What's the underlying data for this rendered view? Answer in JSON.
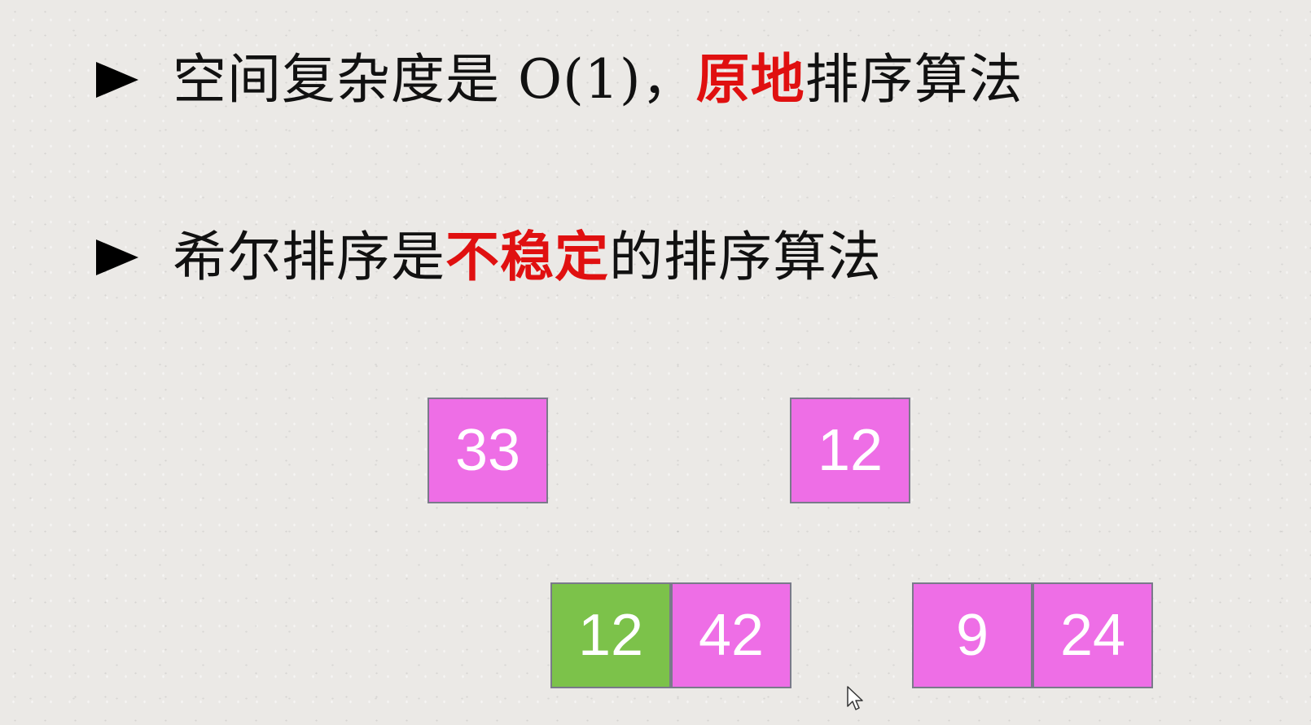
{
  "bullets": [
    {
      "prefix": "空间复杂度是 O(1)，",
      "highlight": "原地",
      "suffix": "排序算法"
    },
    {
      "prefix": "希尔排序是",
      "highlight": "不稳定",
      "suffix": "的排序算法"
    }
  ],
  "boxes": {
    "top_left": "33",
    "top_right": "12",
    "bottom_left_green": "12",
    "bottom_left_pink": "42",
    "bottom_right_first": "9",
    "bottom_right_second": "24"
  },
  "colors": {
    "highlight": "#e01010",
    "pink_box": "#ee6ee6",
    "green_box": "#7cc24a"
  },
  "icons": {
    "bullet": "triangle-right-icon",
    "cursor": "mouse-pointer-icon"
  }
}
